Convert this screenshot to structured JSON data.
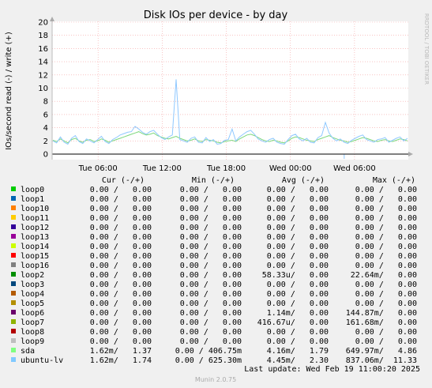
{
  "chart_data": {
    "type": "line",
    "title": "Disk IOs per device - by day",
    "ylabel": "IOs/second read (-) / write (+)",
    "side_label": "RRDTOOL / TOBI OETIKER",
    "ylim": [
      -0.6,
      20
    ],
    "y_ticks": [
      "20",
      "18",
      "16",
      "14",
      "12",
      "10",
      "8",
      "6",
      "4",
      "2",
      "0"
    ],
    "x_ticks": [
      "Tue 06:00",
      "Tue 12:00",
      "Tue 18:00",
      "Wed 00:00",
      "Wed 06:00"
    ],
    "grid": true,
    "series": [
      {
        "name": "sda",
        "color": "#7dd87d",
        "values": [
          2.1,
          1.9,
          2.3,
          2.0,
          1.7,
          2.2,
          2.4,
          2.0,
          1.8,
          2.1,
          2.2,
          1.9,
          2.0,
          2.3,
          2.1,
          1.8,
          2.0,
          2.2,
          2.4,
          2.6,
          2.8,
          3.0,
          3.2,
          3.4,
          3.1,
          2.9,
          3.0,
          3.2,
          2.8,
          2.6,
          2.4,
          2.3,
          2.5,
          2.7,
          2.4,
          2.2,
          2.0,
          2.1,
          2.3,
          2.0,
          1.9,
          2.2,
          2.1,
          2.0,
          1.8,
          1.7,
          1.9,
          2.0,
          2.1,
          1.9,
          2.3,
          2.6,
          2.9,
          3.0,
          2.8,
          2.5,
          2.2,
          2.0,
          1.9,
          2.1,
          2.0,
          1.8,
          1.7,
          2.0,
          2.4,
          2.6,
          2.5,
          2.3,
          2.1,
          2.0,
          1.9,
          2.2,
          2.4,
          2.6,
          2.8,
          2.5,
          2.3,
          2.1,
          2.0,
          1.8,
          1.9,
          2.1,
          2.3,
          2.5,
          2.4,
          2.2,
          2.0,
          1.9,
          2.1,
          2.2,
          2.0,
          1.9,
          2.1,
          2.3,
          2.2,
          2.0
        ]
      },
      {
        "name": "ubuntu-lv",
        "color": "#8fc8ff",
        "values": [
          2.0,
          1.7,
          2.6,
          1.8,
          1.5,
          2.4,
          2.8,
          1.9,
          1.6,
          2.3,
          2.0,
          1.7,
          2.2,
          2.7,
          1.9,
          1.6,
          2.2,
          2.5,
          2.9,
          3.1,
          3.3,
          3.4,
          4.2,
          3.8,
          3.3,
          3.0,
          3.4,
          3.6,
          3.0,
          2.5,
          2.2,
          2.6,
          2.9,
          11.33,
          2.2,
          2.0,
          1.8,
          2.4,
          2.6,
          1.8,
          1.7,
          2.5,
          1.9,
          2.2,
          1.5,
          1.6,
          2.1,
          2.2,
          3.8,
          2.0,
          2.6,
          3.0,
          3.4,
          3.6,
          3.0,
          2.3,
          2.0,
          1.8,
          2.2,
          2.4,
          1.8,
          1.6,
          1.5,
          2.2,
          2.8,
          3.0,
          2.3,
          2.0,
          2.4,
          1.8,
          1.7,
          2.5,
          2.8,
          4.8,
          3.2,
          2.4,
          2.0,
          2.3,
          1.8,
          1.6,
          2.1,
          2.4,
          2.7,
          2.9,
          2.2,
          2.0,
          1.8,
          2.2,
          2.3,
          2.5,
          1.8,
          2.1,
          2.4,
          2.6,
          2.0,
          2.4
        ]
      }
    ],
    "legend": {
      "headers": {
        "cur": "Cur (-/+)",
        "min": "Min (-/+)",
        "avg": "Avg (-/+)",
        "max": "Max (-/+)"
      },
      "rows": [
        {
          "name": "loop0",
          "color": "#00cc00",
          "cur": "0.00 /   0.00",
          "min": "0.00 /   0.00",
          "avg": "0.00 /   0.00",
          "max": "0.00 /   0.00"
        },
        {
          "name": "loop1",
          "color": "#0066b3",
          "cur": "0.00 /   0.00",
          "min": "0.00 /   0.00",
          "avg": "0.00 /   0.00",
          "max": "0.00 /   0.00"
        },
        {
          "name": "loop10",
          "color": "#ff8000",
          "cur": "0.00 /   0.00",
          "min": "0.00 /   0.00",
          "avg": "0.00 /   0.00",
          "max": "0.00 /   0.00"
        },
        {
          "name": "loop11",
          "color": "#ffcc00",
          "cur": "0.00 /   0.00",
          "min": "0.00 /   0.00",
          "avg": "0.00 /   0.00",
          "max": "0.00 /   0.00"
        },
        {
          "name": "loop12",
          "color": "#330099",
          "cur": "0.00 /   0.00",
          "min": "0.00 /   0.00",
          "avg": "0.00 /   0.00",
          "max": "0.00 /   0.00"
        },
        {
          "name": "loop13",
          "color": "#990099",
          "cur": "0.00 /   0.00",
          "min": "0.00 /   0.00",
          "avg": "0.00 /   0.00",
          "max": "0.00 /   0.00"
        },
        {
          "name": "loop14",
          "color": "#ccff00",
          "cur": "0.00 /   0.00",
          "min": "0.00 /   0.00",
          "avg": "0.00 /   0.00",
          "max": "0.00 /   0.00"
        },
        {
          "name": "loop15",
          "color": "#ff0000",
          "cur": "0.00 /   0.00",
          "min": "0.00 /   0.00",
          "avg": "0.00 /   0.00",
          "max": "0.00 /   0.00"
        },
        {
          "name": "loop16",
          "color": "#808080",
          "cur": "0.00 /   0.00",
          "min": "0.00 /   0.00",
          "avg": "0.00 /   0.00",
          "max": "0.00 /   0.00"
        },
        {
          "name": "loop2",
          "color": "#008f00",
          "cur": "0.00 /   0.00",
          "min": "0.00 /   0.00",
          "avg": "58.33u/   0.00",
          "max": "22.64m/   0.00"
        },
        {
          "name": "loop3",
          "color": "#00487d",
          "cur": "0.00 /   0.00",
          "min": "0.00 /   0.00",
          "avg": "0.00 /   0.00",
          "max": "0.00 /   0.00"
        },
        {
          "name": "loop4",
          "color": "#b35a00",
          "cur": "0.00 /   0.00",
          "min": "0.00 /   0.00",
          "avg": "0.00 /   0.00",
          "max": "0.00 /   0.00"
        },
        {
          "name": "loop5",
          "color": "#b38f00",
          "cur": "0.00 /   0.00",
          "min": "0.00 /   0.00",
          "avg": "0.00 /   0.00",
          "max": "0.00 /   0.00"
        },
        {
          "name": "loop6",
          "color": "#6b006b",
          "cur": "0.00 /   0.00",
          "min": "0.00 /   0.00",
          "avg": "1.14m/   0.00",
          "max": "144.87m/   0.00"
        },
        {
          "name": "loop7",
          "color": "#8fb300",
          "cur": "0.00 /   0.00",
          "min": "0.00 /   0.00",
          "avg": "416.67u/   0.00",
          "max": "161.68m/   0.00"
        },
        {
          "name": "loop8",
          "color": "#b30000",
          "cur": "0.00 /   0.00",
          "min": "0.00 /   0.00",
          "avg": "0.00 /   0.00",
          "max": "0.00 /   0.00"
        },
        {
          "name": "loop9",
          "color": "#bebebe",
          "cur": "0.00 /   0.00",
          "min": "0.00 /   0.00",
          "avg": "0.00 /   0.00",
          "max": "0.00 /   0.00"
        },
        {
          "name": "sda",
          "color": "#80ff80",
          "cur": "1.62m/   1.37",
          "min": "0.00 / 406.75m",
          "avg": "4.16m/   1.79",
          "max": "649.97m/   4.86"
        },
        {
          "name": "ubuntu-lv",
          "color": "#80c9ff",
          "cur": "1.62m/   1.74",
          "min": "0.00 / 625.30m",
          "avg": "4.45m/   2.30",
          "max": "837.06m/  11.33"
        }
      ]
    },
    "last_update": "Last update: Wed Feb 19 11:00:20 2025",
    "footer": "Munin 2.0.75"
  }
}
